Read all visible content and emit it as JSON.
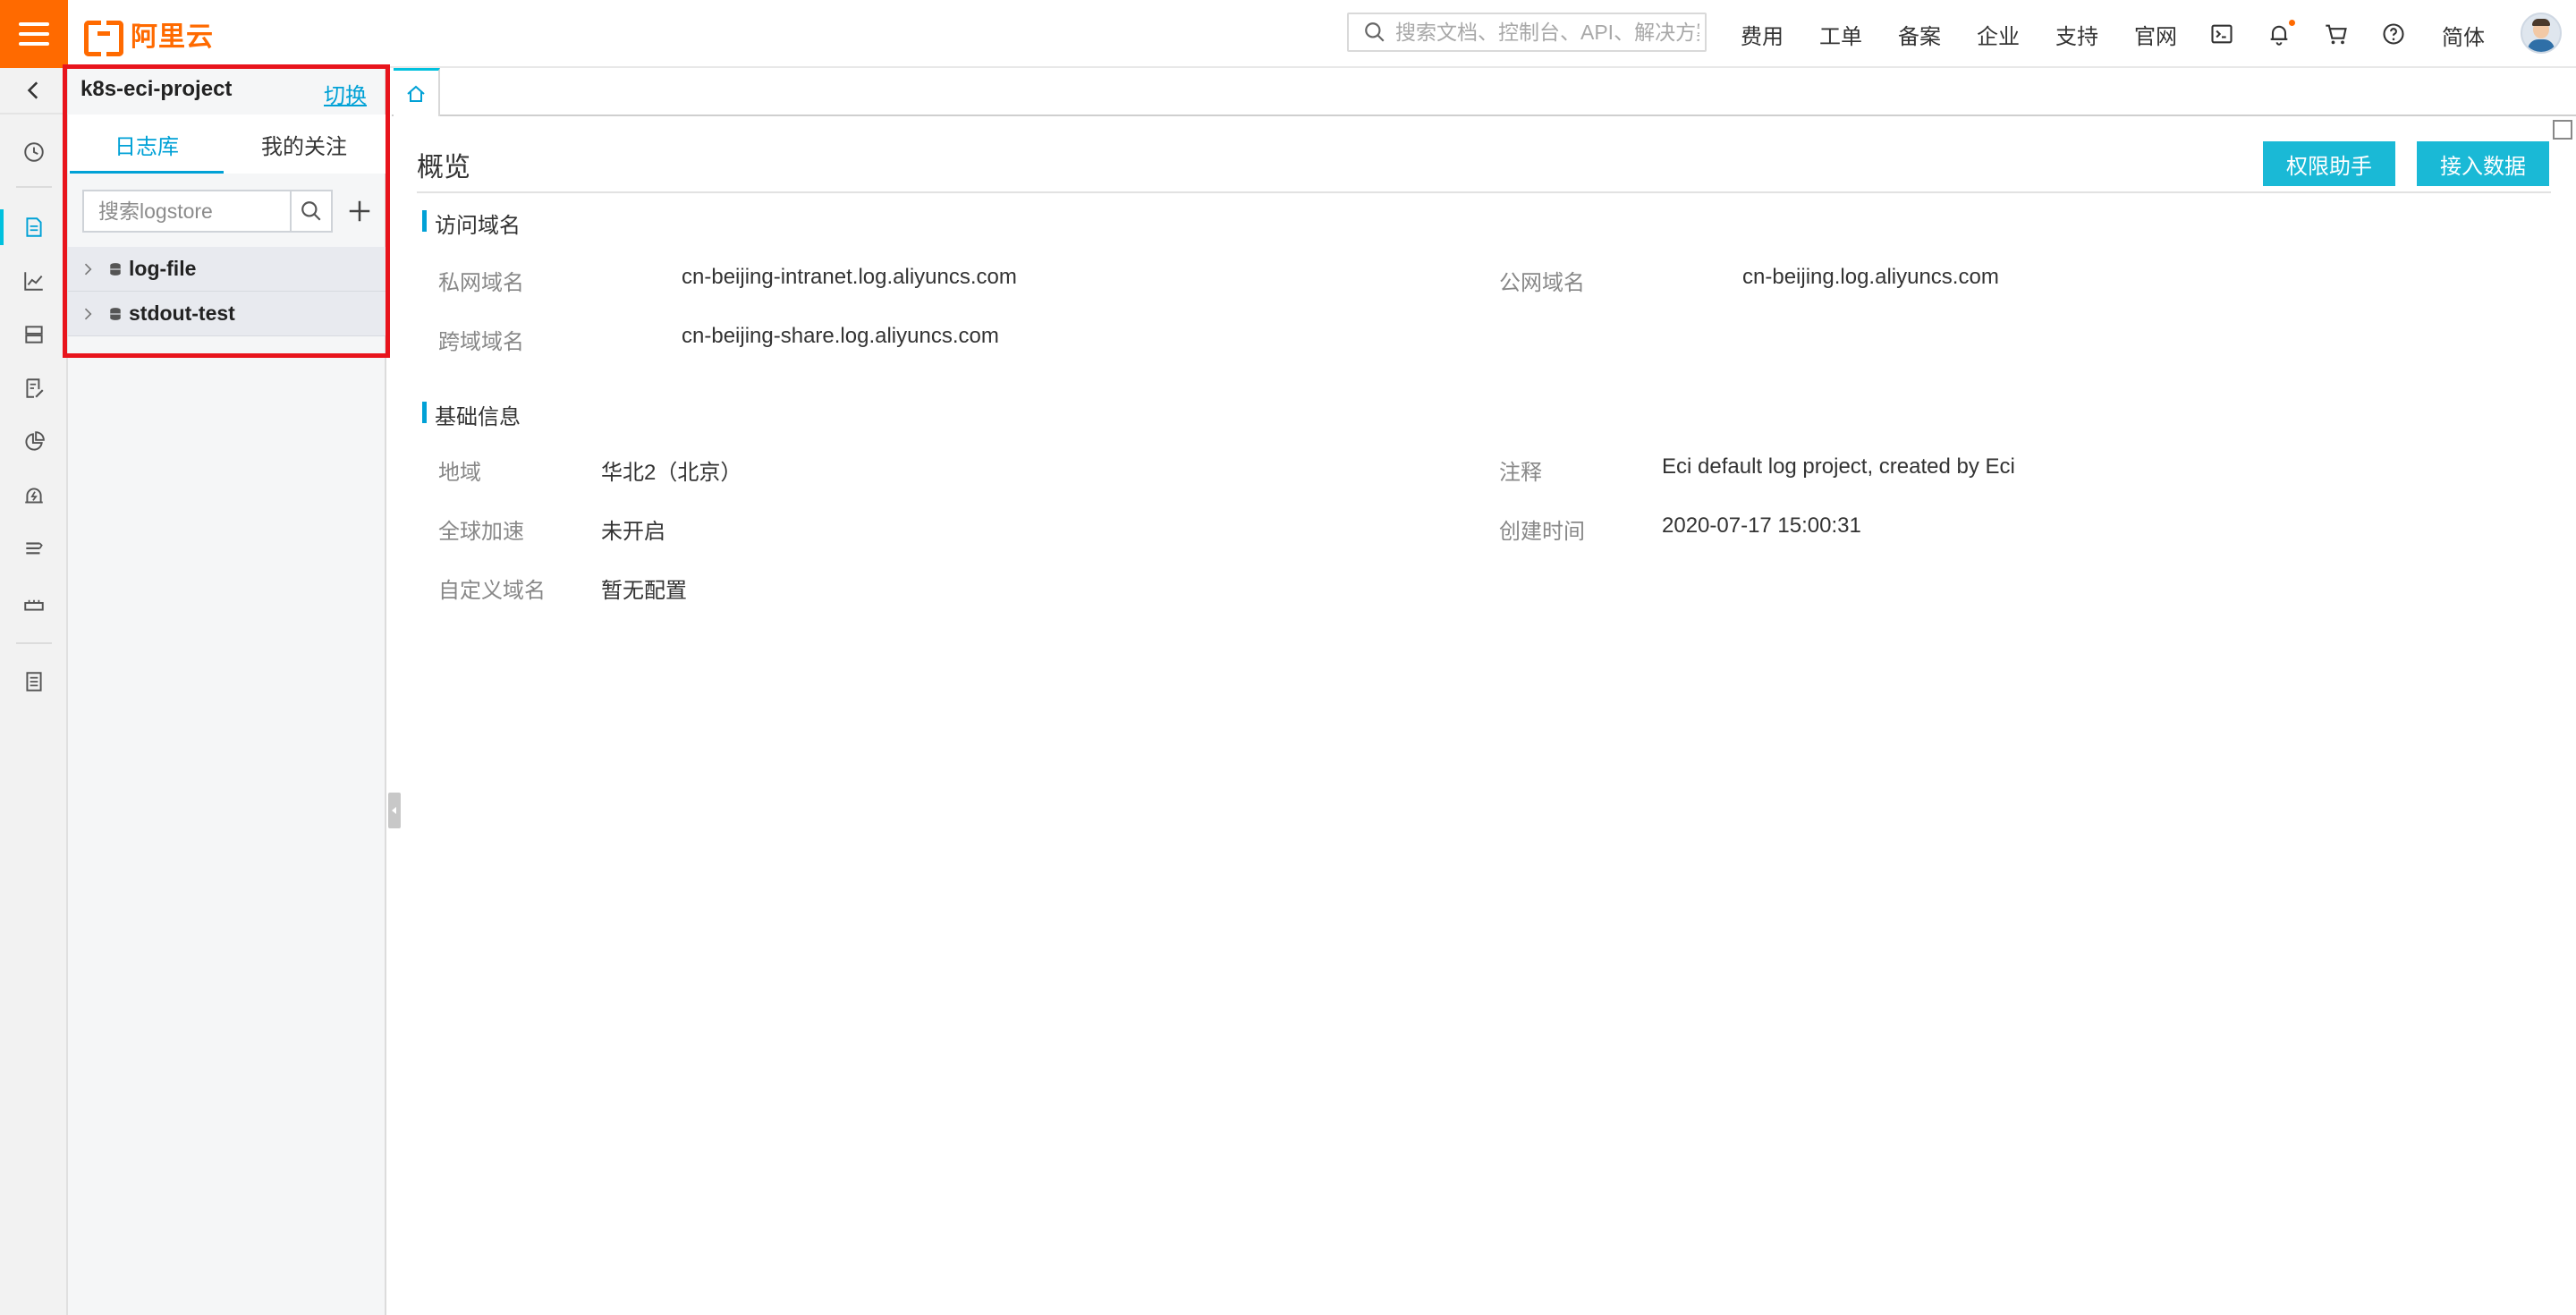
{
  "topbar": {
    "brand": "阿里云",
    "search_placeholder": "搜索文档、控制台、API、解决方案和资源",
    "nav": [
      "费用",
      "工单",
      "备案",
      "企业",
      "支持",
      "官网"
    ],
    "icons": [
      "terminal-icon",
      "bell-icon",
      "cart-icon",
      "help-icon"
    ],
    "lang": "简体"
  },
  "rail": {
    "items": [
      "clock-icon",
      "logstore-icon",
      "chart-icon",
      "storage-icon",
      "edit-icon",
      "pie-icon",
      "alert-icon",
      "list-icon",
      "machine-icon",
      "book-icon"
    ],
    "active": "logstore-icon"
  },
  "panel": {
    "project_name": "k8s-eci-project",
    "switch_label": "切换",
    "tabs": [
      "日志库",
      "我的关注"
    ],
    "search_placeholder": "搜索logstore",
    "logstores": [
      "log-file",
      "stdout-test"
    ]
  },
  "main": {
    "title": "概览",
    "buttons": {
      "permission": "权限助手",
      "ingest": "接入数据"
    },
    "domain_section": {
      "title": "访问域名",
      "private_label": "私网域名",
      "private_value": "cn-beijing-intranet.log.aliyuncs.com",
      "public_label": "公网域名",
      "public_value": "cn-beijing.log.aliyuncs.com",
      "cross_label": "跨域域名",
      "cross_value": "cn-beijing-share.log.aliyuncs.com"
    },
    "basic_section": {
      "title": "基础信息",
      "region_label": "地域",
      "region_value": "华北2（北京）",
      "comment_label": "注释",
      "comment_value": "Eci default log project, created by Eci",
      "accel_label": "全球加速",
      "accel_value": "未开启",
      "created_label": "创建时间",
      "created_value": "2020-07-17 15:00:31",
      "custom_domain_label": "自定义域名",
      "custom_domain_value": "暂无配置"
    }
  },
  "colors": {
    "brand": "#ff6a00",
    "accent": "#00a1d6",
    "button": "#1ab9d6",
    "highlight": "#e8141c"
  }
}
